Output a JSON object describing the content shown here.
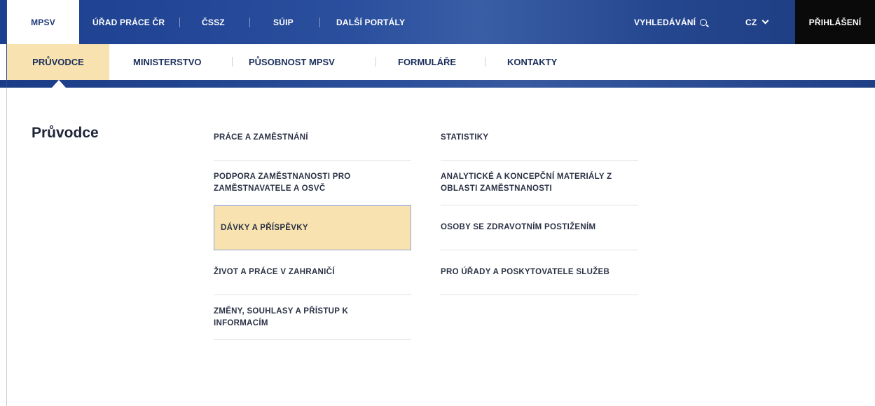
{
  "topbar": {
    "mpsv": "MPSV",
    "links": [
      "ÚŘAD PRÁCE ČR",
      "ČSSZ",
      "SÚIP",
      "DALŠÍ PORTÁLY"
    ],
    "search": "VYHLEDÁVÁNÍ",
    "language": "CZ",
    "login": "PŘIHLÁŠENÍ"
  },
  "mainnav": {
    "items": [
      "PRŮVODCE",
      "MINISTERSTVO",
      "PŮSOBNOST MPSV",
      "FORMULÁŘE",
      "KONTAKTY"
    ],
    "active": "PRŮVODCE"
  },
  "content": {
    "heading": "Průvodce",
    "column1": [
      "PRÁCE A ZAMĚSTNÁNÍ",
      "PODPORA ZAMĚSTNANOSTI PRO ZAMĚSTNAVATELE A OSVČ",
      "DÁVKY A PŘÍSPĚVKY",
      "ŽIVOT A PRÁCE V ZAHRANIČÍ",
      "ZMĚNY, SOUHLASY A PŘÍSTUP K INFORMACÍM"
    ],
    "column2": [
      "STATISTIKY",
      "ANALYTICKÉ A KONCEPČNÍ MATERIÁLY Z OBLASTI ZAMĚSTNANOSTI",
      "OSOBY SE ZDRAVOTNÍM POSTIŽENÍM",
      "PRO ÚŘADY A POSKYTOVATELE SLUŽEB"
    ],
    "highlighted": "DÁVKY A PŘÍSPĚVKY"
  },
  "colors": {
    "topbar_blue": "#1c3f8f",
    "accent_yellow": "#f8e3b0",
    "login_black": "#0a0a0a",
    "text_dark": "#1c2f5c"
  }
}
